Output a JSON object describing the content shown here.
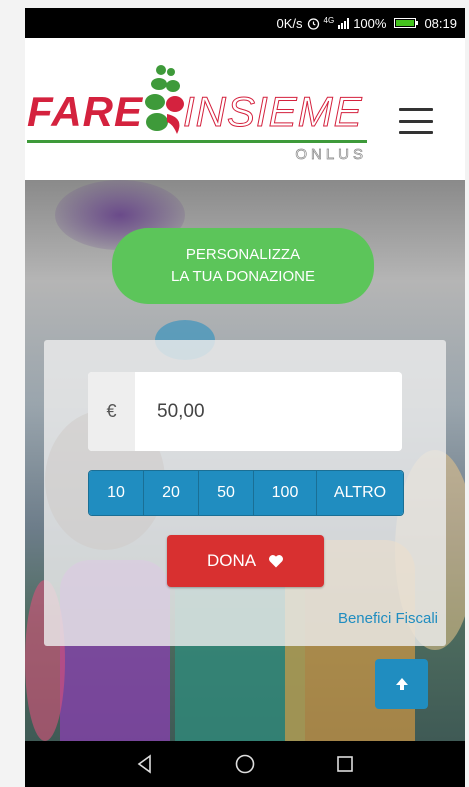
{
  "statusbar": {
    "speed": "0K/s",
    "network": "4G",
    "battery": "100%",
    "time": "08:19"
  },
  "header": {
    "logo_word1": "FARE",
    "logo_word2": "INSIEME",
    "logo_sub": "ONLUS",
    "brand_red": "#d4223e",
    "brand_green": "#3e9a3a"
  },
  "hero": {
    "cta_line1": "PERSONALIZZA",
    "cta_line2": "LA TUA DONAZIONE",
    "currency": "€",
    "amount": "50,00",
    "presets": [
      "10",
      "20",
      "50",
      "100",
      "ALTRO"
    ],
    "donate_label": "DONA",
    "benefici_link": "Benefici Fiscali",
    "accent_green": "#5cc55a",
    "accent_blue": "#208dc0",
    "accent_red": "#d83030"
  }
}
